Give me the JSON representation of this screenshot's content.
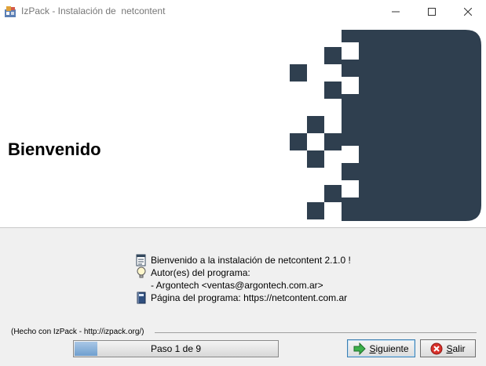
{
  "window": {
    "title": "IzPack - Instalación de  netcontent",
    "icons": {
      "app": "izpack-app-icon",
      "minimize": "minimize-icon",
      "maximize": "maximize-icon",
      "close": "close-icon"
    }
  },
  "header": {
    "title": "Bienvenido",
    "colors": {
      "logo": "#2f3f4f"
    }
  },
  "info": {
    "welcome_text": "Bienvenido a la instalación de netcontent 2.1.0 !",
    "authors_label": "Autor(es) del programa:",
    "author_entry": "- Argontech <ventas@argontech.com.ar>",
    "homepage_text": "Página del programa: https://netcontent.com.ar"
  },
  "footer": {
    "made_with": "(Hecho con IzPack - http://izpack.org/)",
    "progress": {
      "label": "Paso 1 de 9",
      "current": 1,
      "total": 9
    },
    "next_label": "Siguiente",
    "quit_label": "Salir"
  }
}
